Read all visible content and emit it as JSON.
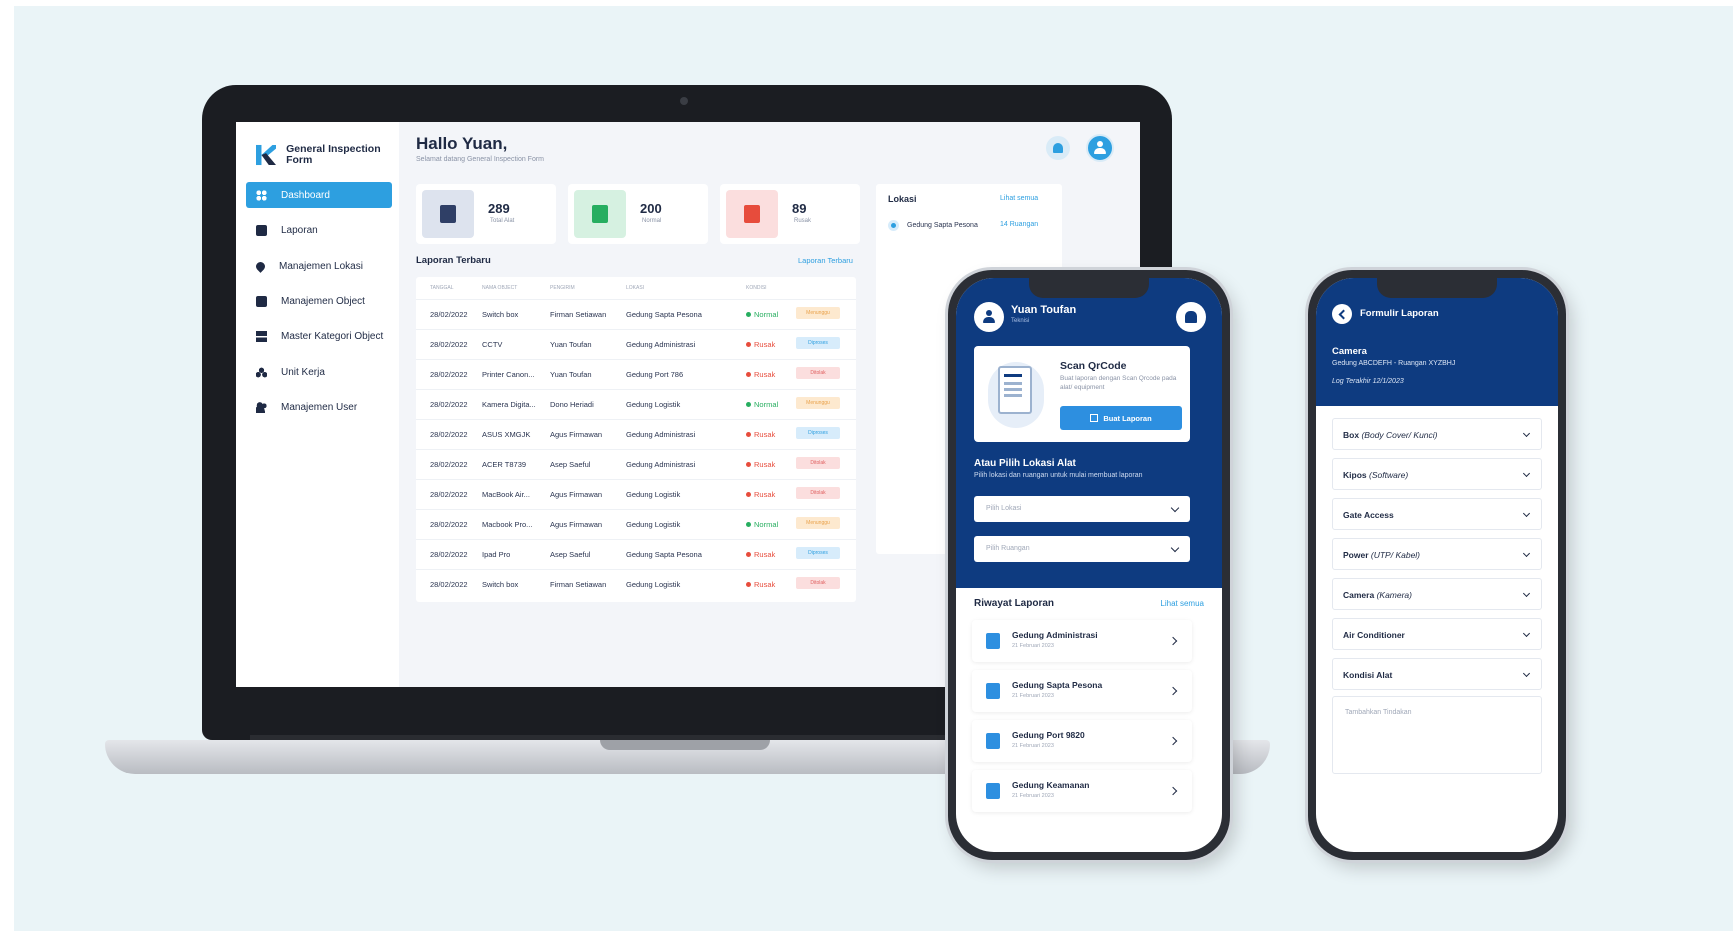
{
  "desktop": {
    "app_title": "General Inspection Form",
    "sidebar": [
      {
        "label": "Dashboard",
        "icon": "dashboard-icon",
        "active": true
      },
      {
        "label": "Laporan",
        "icon": "document-icon"
      },
      {
        "label": "Manajemen Lokasi",
        "icon": "location-pin-icon"
      },
      {
        "label": "Manajemen Object",
        "icon": "box-icon"
      },
      {
        "label": "Master Kategori Object",
        "icon": "category-icon"
      },
      {
        "label": "Unit Kerja",
        "icon": "unit-icon"
      },
      {
        "label": "Manajemen User",
        "icon": "users-icon"
      }
    ],
    "greeting": "Hallo Yuan,",
    "greeting_sub": "Selamat datang General Inspection Form",
    "stats": [
      {
        "value": "289",
        "label": "Total Alat",
        "color": "#2f3f66",
        "bg": "#dde3ee"
      },
      {
        "value": "200",
        "label": "Normal",
        "color": "#27ae60",
        "bg": "#d6f1e1"
      },
      {
        "value": "89",
        "label": "Rusak",
        "color": "#e74c3c",
        "bg": "#fbdede"
      }
    ],
    "table": {
      "title": "Laporan Terbaru",
      "link": "Laporan Terbaru",
      "headers": [
        "Tanggal",
        "Nama Object",
        "Pengirim",
        "Lokasi",
        "Kondisi"
      ],
      "rows": [
        [
          "28/02/2022",
          "Switch box",
          "Firman Setiawan",
          "Gedung Sapta Pesona",
          "Normal",
          "Menunggu"
        ],
        [
          "28/02/2022",
          "CCTV",
          "Yuan Toufan",
          "Gedung Administrasi",
          "Rusak",
          "Diproses"
        ],
        [
          "28/02/2022",
          "Printer Canon...",
          "Yuan Toufan",
          "Gedung Port 786",
          "Rusak",
          "Ditolak"
        ],
        [
          "28/02/2022",
          "Kamera Digita...",
          "Dono Heriadi",
          "Gedung Logistik",
          "Normal",
          "Menunggu"
        ],
        [
          "28/02/2022",
          "ASUS XMGJK",
          "Agus Firmawan",
          "Gedung Administrasi",
          "Rusak",
          "Diproses"
        ],
        [
          "28/02/2022",
          "ACER T8739",
          "Asep Saeful",
          "Gedung Administrasi",
          "Rusak",
          "Ditolak"
        ],
        [
          "28/02/2022",
          "MacBook Air...",
          "Agus Firmawan",
          "Gedung Logistik",
          "Rusak",
          "Ditolak"
        ],
        [
          "28/02/2022",
          "Macbook Pro...",
          "Agus Firmawan",
          "Gedung Logistik",
          "Normal",
          "Menunggu"
        ],
        [
          "28/02/2022",
          "Ipad Pro",
          "Asep Saeful",
          "Gedung Sapta Pesona",
          "Rusak",
          "Diproses"
        ],
        [
          "28/02/2022",
          "Switch box",
          "Firman Setiawan",
          "Gedung Logistik",
          "Rusak",
          "Ditolak"
        ]
      ]
    },
    "lokasi": {
      "title": "Lokasi",
      "link": "Lihat semua",
      "first_name": "Gedung Sapta Pesona",
      "first_count": "14 Ruangan"
    }
  },
  "phone1": {
    "user_name": "Yuan Toufan",
    "user_role": "Teknisi",
    "scan_title": "Scan QrCode",
    "scan_desc": "Buat laporan dengan Scan Qrcode pada alat/ equipment",
    "scan_button": "Buat Laporan",
    "pick_title": "Atau Pilih Lokasi Alat",
    "pick_sub": "Pilih lokasi dan ruangan untuk mulai membuat laporan",
    "select_lokasi": "Pilih Lokasi",
    "select_ruangan": "Pilih Ruangan",
    "history_title": "Riwayat Laporan",
    "history_link": "Lihat semua",
    "history": [
      {
        "name": "Gedung Administrasi",
        "date": "21 Februari 2023"
      },
      {
        "name": "Gedung Sapta Pesona",
        "date": "21 Februari 2023"
      },
      {
        "name": "Gedung Port 9820",
        "date": "21 Februari 2023"
      },
      {
        "name": "Gedung Keamanan",
        "date": "21 Februari 2023"
      }
    ]
  },
  "phone2": {
    "title": "Formulir Laporan",
    "item": "Camera",
    "location": "Gedung ABCDEFH - Ruangan XYZBHJ",
    "last_check": "Log Terakhir 12/1/2023",
    "fields": [
      {
        "label": "Box",
        "hint": "(Body Cover/ Kunci)"
      },
      {
        "label": "Kipos",
        "hint": "(Software)"
      },
      {
        "label": "Gate Access",
        "hint": ""
      },
      {
        "label": "Power",
        "hint": "(UTP/ Kabel)"
      },
      {
        "label": "Camera",
        "hint": "(Kamera)"
      },
      {
        "label": "Air Conditioner",
        "hint": ""
      },
      {
        "label": "Kondisi Alat",
        "hint": ""
      }
    ],
    "note_placeholder": "Tambahkan Tindakan"
  }
}
